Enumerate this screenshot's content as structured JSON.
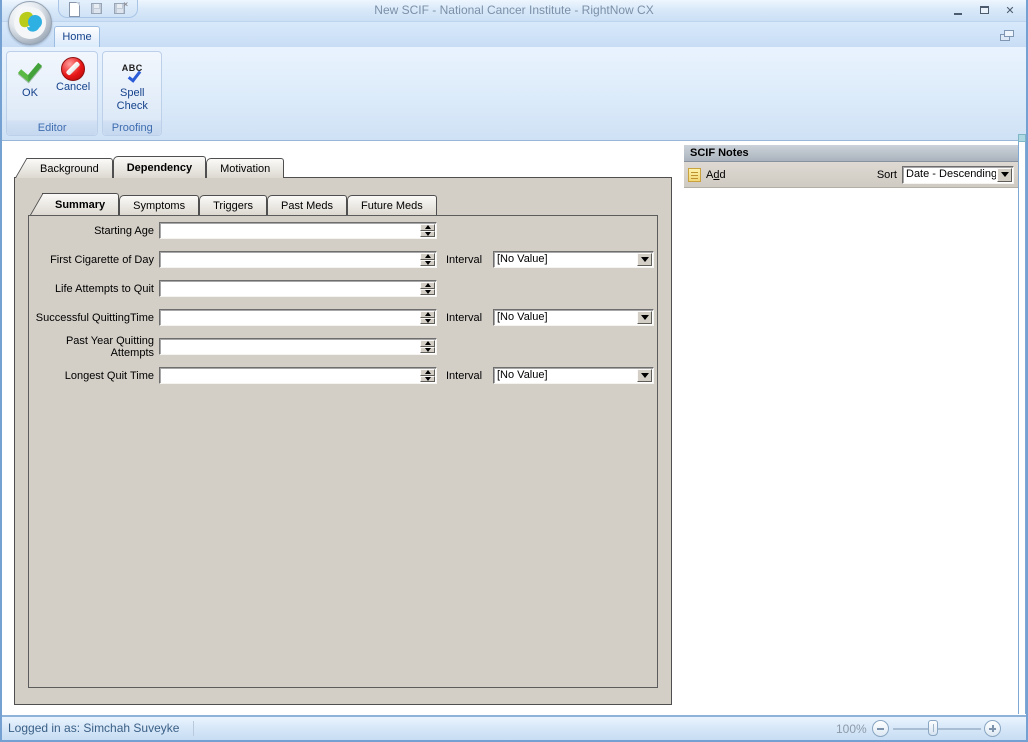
{
  "window": {
    "title": "New SCIF - National Cancer Institute - RightNow CX"
  },
  "quick_access": {
    "icons": [
      "new-document-icon",
      "save-icon",
      "save-close-icon"
    ]
  },
  "ribbon": {
    "tabs": [
      {
        "label": "Home",
        "active": true
      }
    ],
    "groups": [
      {
        "label": "Editor",
        "buttons": [
          {
            "label": "OK",
            "icon": "ok-check"
          },
          {
            "label": "Cancel",
            "icon": "cancel"
          }
        ]
      },
      {
        "label": "Proofing",
        "buttons": [
          {
            "label": "Spell Check",
            "icon": "spell-check"
          }
        ]
      }
    ]
  },
  "editor": {
    "tabs": [
      {
        "label": "Background",
        "active": false
      },
      {
        "label": "Dependency",
        "active": true
      },
      {
        "label": "Motivation",
        "active": false
      }
    ],
    "subtabs": [
      {
        "label": "Summary",
        "active": true
      },
      {
        "label": "Symptoms",
        "active": false
      },
      {
        "label": "Triggers",
        "active": false
      },
      {
        "label": "Past Meds",
        "active": false
      },
      {
        "label": "Future Meds",
        "active": false
      }
    ],
    "fields": [
      {
        "label": "Starting Age",
        "value": "",
        "has_interval": false
      },
      {
        "label": "First Cigarette of Day",
        "value": "",
        "has_interval": true,
        "interval_label": "Interval",
        "interval_value": "[No Value]"
      },
      {
        "label": "Life Attempts to Quit",
        "value": "",
        "has_interval": false
      },
      {
        "label": "Successful QuittingTime",
        "value": "",
        "has_interval": true,
        "interval_label": "Interval",
        "interval_value": "[No Value]"
      },
      {
        "label": "Past Year Quitting Attempts",
        "value": "",
        "has_interval": false
      },
      {
        "label": "Longest Quit Time",
        "value": "",
        "has_interval": true,
        "interval_label": "Interval",
        "interval_value": "[No Value]"
      }
    ]
  },
  "notes": {
    "title": "SCIF Notes",
    "add": {
      "prefix": "A",
      "mnemonic": "d",
      "suffix": "d"
    },
    "sort_label": "Sort",
    "sort_value": "Date - Descending"
  },
  "status": {
    "logged_in_as": "Logged in as: Simchah Suveyke",
    "zoom_level": "100%"
  },
  "colors": {
    "accent_blue": "#15428b",
    "chrome_blue": "#d3e3f6",
    "panel_gray": "#d3cfc7",
    "notes_header_gray": "#aab3bd",
    "window_border": "#74a0d2"
  }
}
